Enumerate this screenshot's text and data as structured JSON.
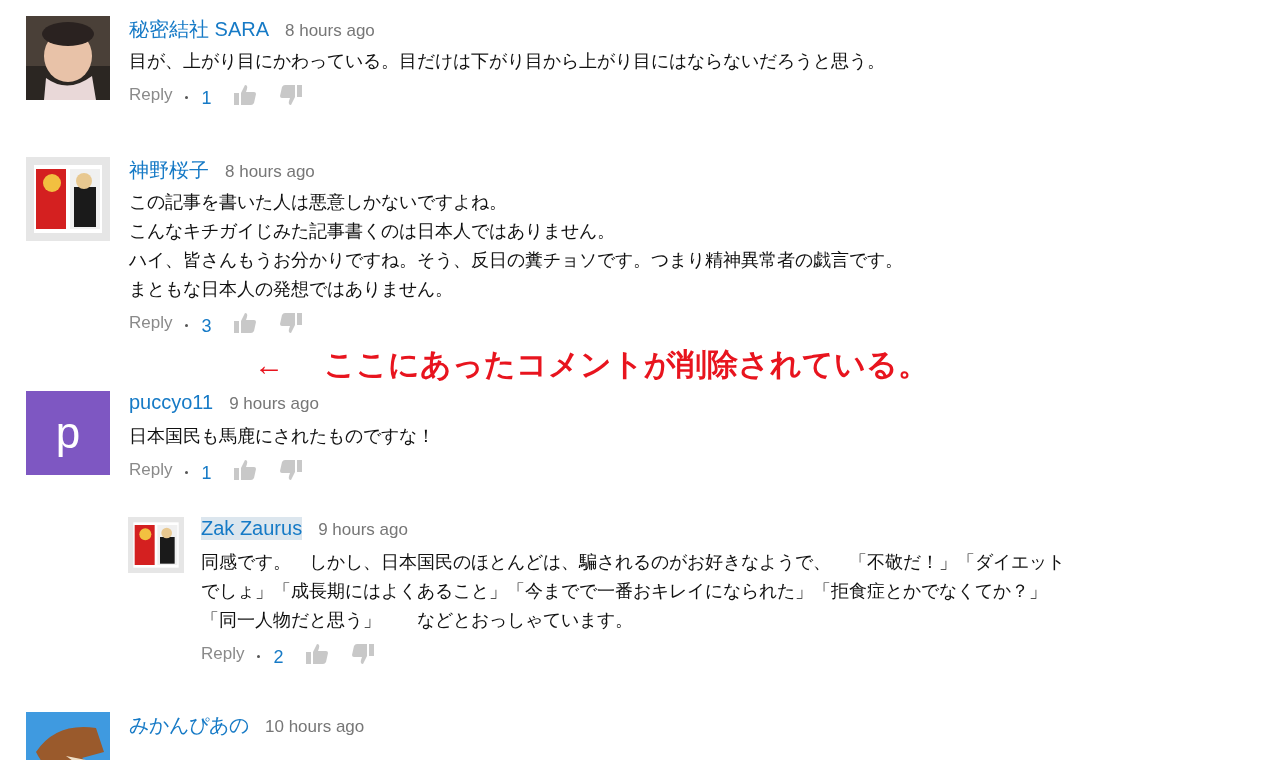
{
  "items": [
    {
      "kind": "comment",
      "author": "秘密結社 SARA",
      "time": "8 hours ago",
      "avatar": {
        "kind": "picture"
      },
      "lines": [
        "目が、上がり目にかわっている。目だけは下がり目から上がり目にはならないだろうと思う。"
      ],
      "reply": "Reply",
      "likes": "1"
    },
    {
      "kind": "comment",
      "author": "神野桜子",
      "time": "8 hours ago",
      "avatar": {
        "kind": "picture"
      },
      "lines": [
        "この記事を書いた人は悪意しかないですよね。",
        "こんなキチガイじみた記事書くのは日本人ではありません。",
        "ハイ、皆さんもうお分かりですね。そう、反日の糞チョソです。つまり精神異常者の戯言です。",
        "まともな日本人の発想ではありません。"
      ],
      "reply": "Reply",
      "likes": "3"
    },
    {
      "kind": "notice",
      "arrow": "←",
      "text": "ここにあったコメントが削除されている。"
    },
    {
      "kind": "comment",
      "author": "puccyo11",
      "time": "9 hours ago",
      "avatar": {
        "kind": "letter",
        "letter": "p",
        "color": "#7e57c2"
      },
      "lines": [
        "日本国民も馬鹿にされたものですな！"
      ],
      "reply": "Reply",
      "likes": "1",
      "children": [
        {
          "kind": "comment",
          "author": "Zak Zaurus",
          "author_highlighted": true,
          "time": "9 hours ago",
          "avatar": {
            "kind": "picture"
          },
          "lines": [
            "同感です。　しかし、日本国民のほとんどは、騙されるのがお好きなようで、　「不敬だ！」「ダイエット",
            "でしょ」「成長期にはよくあること」「今までで一番おキレイになられた」「拒食症とかでなくてか？」",
            "「同一人物だと思う」　　などとおっしゃています。"
          ],
          "reply": "Reply",
          "likes": "2"
        }
      ]
    },
    {
      "kind": "comment",
      "author": "みかんぴあの",
      "time": "10 hours ago",
      "avatar": {
        "kind": "picture"
      }
    }
  ]
}
